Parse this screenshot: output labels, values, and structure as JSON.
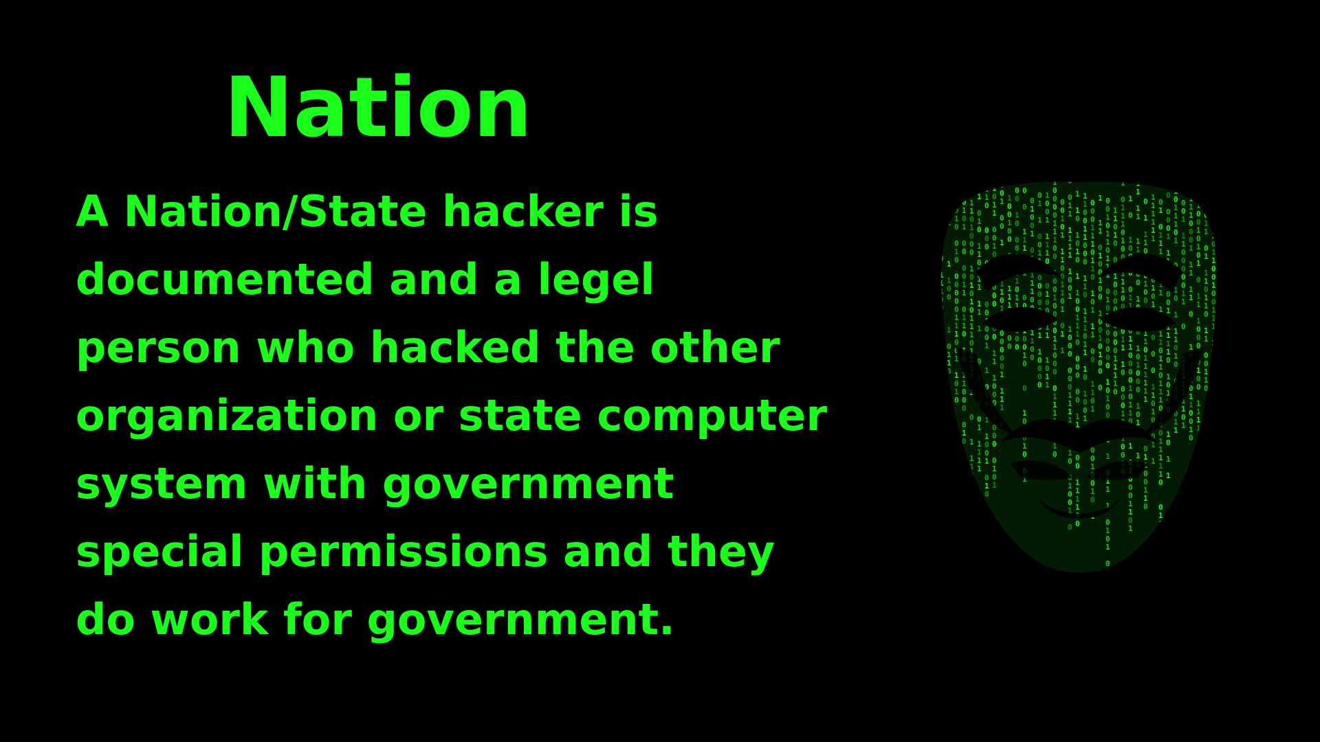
{
  "slide": {
    "title": "Nation",
    "body_lines": [
      "A Nation/State hacker is",
      "documented and a legel",
      "person who hacked the other",
      "organization or state computer",
      "system with government",
      "special permissions and they",
      "do work for government."
    ],
    "image": {
      "icon": "matrix-code-mask-icon"
    }
  },
  "colors": {
    "background": "#000000",
    "text": "#1aff1a",
    "code_green": "#22ff22"
  }
}
